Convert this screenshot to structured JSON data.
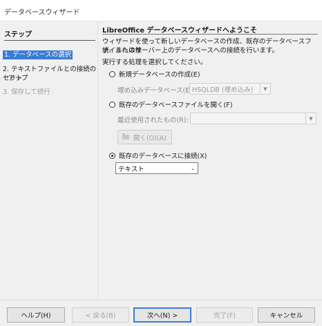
{
  "window": {
    "title": "データベースウィザード"
  },
  "sidebar": {
    "heading": "ステップ",
    "steps": [
      {
        "label": "1. データベースの選択",
        "state": "active"
      },
      {
        "label": "2. テキストファイルとの接続のセット",
        "state": "normal"
      },
      {
        "label": "アップ",
        "state": "normal"
      },
      {
        "label": "3. 保存して続行",
        "state": "disabled"
      }
    ]
  },
  "main": {
    "heading": "LibreOffice データベースウィザードへようこそ",
    "intro_line1": "ウィザードを使って新しいデータベースの作成、既存のデータベースファイルへの接",
    "intro_line2": "続、またはサーバー上のデータベースへの接続を行います。",
    "prompt": "実行する処理を選択してください。",
    "option_new": {
      "label": "新規データベースの作成(E)",
      "checked": false
    },
    "embedded_label": "埋め込みデータベース(E):",
    "embedded_value": "HSQLDB (埋め込み)",
    "option_open": {
      "label": "既存のデータベースファイルを開く(F)",
      "checked": false
    },
    "recent_label": "最近使用されたもの(R):",
    "recent_value": "",
    "open_button": "開く(O)(A)",
    "option_connect": {
      "label": "既存のデータベースに接続(X)",
      "checked": true
    },
    "connect_value": "テキスト"
  },
  "footer": {
    "help": "ヘルプ(H)",
    "back": "< 戻る(B)",
    "next": "次へ(N) >",
    "finish": "完了(F)",
    "cancel": "キャンセル"
  },
  "icons": {
    "dropdown": "chevron-down-icon",
    "folder": "folder-icon"
  },
  "colors": {
    "accent": "#3a7bd5",
    "disabled_text": "#a0a0a0"
  }
}
